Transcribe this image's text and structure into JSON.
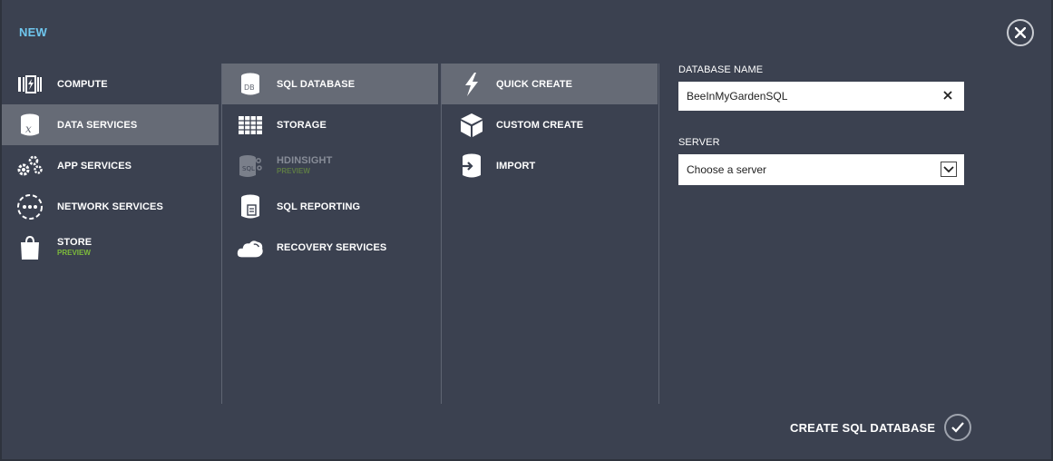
{
  "dialog": {
    "title": "NEW",
    "close_icon": "close-icon"
  },
  "categories": [
    {
      "label": "COMPUTE",
      "icon": "compute-icon",
      "selected": false
    },
    {
      "label": "DATA SERVICES",
      "icon": "data-services-icon",
      "selected": true
    },
    {
      "label": "APP SERVICES",
      "icon": "gears-icon",
      "selected": false
    },
    {
      "label": "NETWORK SERVICES",
      "icon": "network-icon",
      "selected": false
    },
    {
      "label": "STORE",
      "sublabel": "PREVIEW",
      "icon": "shopping-bag-icon",
      "selected": false
    }
  ],
  "services": [
    {
      "label": "SQL DATABASE",
      "icon": "database-icon",
      "selected": true
    },
    {
      "label": "STORAGE",
      "icon": "storage-grid-icon",
      "selected": false
    },
    {
      "label": "HDINSIGHT",
      "sublabel": "PREVIEW",
      "icon": "hdinsight-icon",
      "disabled": true
    },
    {
      "label": "SQL REPORTING",
      "icon": "report-icon",
      "selected": false
    },
    {
      "label": "RECOVERY SERVICES",
      "icon": "cloud-icon",
      "selected": false
    }
  ],
  "actions": [
    {
      "label": "QUICK CREATE",
      "icon": "lightning-icon",
      "selected": true
    },
    {
      "label": "CUSTOM CREATE",
      "icon": "box-icon",
      "selected": false
    },
    {
      "label": "IMPORT",
      "icon": "import-icon",
      "selected": false
    }
  ],
  "form": {
    "database_name_label": "DATABASE NAME",
    "database_name_value": "BeeInMyGardenSQL",
    "server_label": "SERVER",
    "server_value": "Choose a server"
  },
  "footer": {
    "create_label": "CREATE SQL DATABASE"
  },
  "colors": {
    "background": "#3b4150",
    "selected": "#666b76",
    "title_accent": "#6fc6ee",
    "preview_green": "#7dbb3b"
  }
}
